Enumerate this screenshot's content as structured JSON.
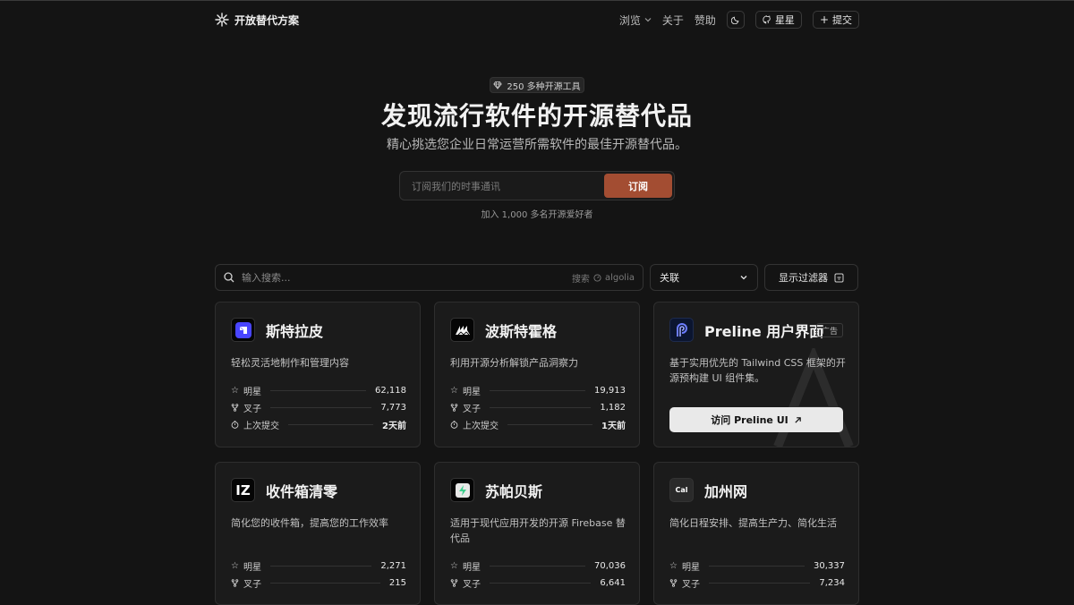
{
  "header": {
    "brand": "开放替代方案",
    "nav": {
      "browse": "浏览",
      "about": "关于",
      "sponsor": "赞助",
      "stars": "星星",
      "submit": "提交"
    }
  },
  "hero": {
    "badge": "250 多种开源工具",
    "title": "发现流行软件的开源替代品",
    "subtitle": "精心挑选您企业日常运营所需软件的最佳开源替代品。",
    "email_placeholder": "订阅我们的时事通讯",
    "subscribe_label": "订阅",
    "join_text": "加入 1,000 多名开源爱好者"
  },
  "toolbar": {
    "search_placeholder": "输入搜索...",
    "search_by": "搜索",
    "algolia": "algolia",
    "sort_value": "关联",
    "filters_label": "显示过滤器"
  },
  "stat_labels": {
    "stars": "明星",
    "forks": "叉子",
    "last_commit": "上次提交"
  },
  "cards": [
    {
      "name": "斯特拉皮",
      "desc": "轻松灵活地制作和管理内容",
      "stars": "62,118",
      "forks": "7,773",
      "last": "2天前"
    },
    {
      "name": "波斯特霍格",
      "desc": "利用开源分析解锁产品洞察力",
      "stars": "19,913",
      "forks": "1,182",
      "last": "1天前"
    },
    {
      "name": "收件箱清零",
      "desc": "简化您的收件箱，提高您的工作效率",
      "stars": "2,271",
      "forks": "215"
    },
    {
      "name": "苏帕贝斯",
      "desc": "适用于现代应用开发的开源 Firebase 替代品",
      "stars": "70,036",
      "forks": "6,641"
    },
    {
      "name": "加州网",
      "desc": "简化日程安排、提高生产力、简化生活",
      "stars": "30,337",
      "forks": "7,234"
    }
  ],
  "ad": {
    "name": "Preline 用户界面",
    "tag": "广告",
    "desc": "基于实用优先的 Tailwind CSS 框架的开源预构建 UI 组件集。",
    "button": "访问 Preline UI"
  },
  "logo_text": {
    "inbox": "IZ",
    "cal": "Cal"
  },
  "colors": {
    "accent": "#a34d32",
    "background": "#141414",
    "card": "#1b1b1b"
  }
}
